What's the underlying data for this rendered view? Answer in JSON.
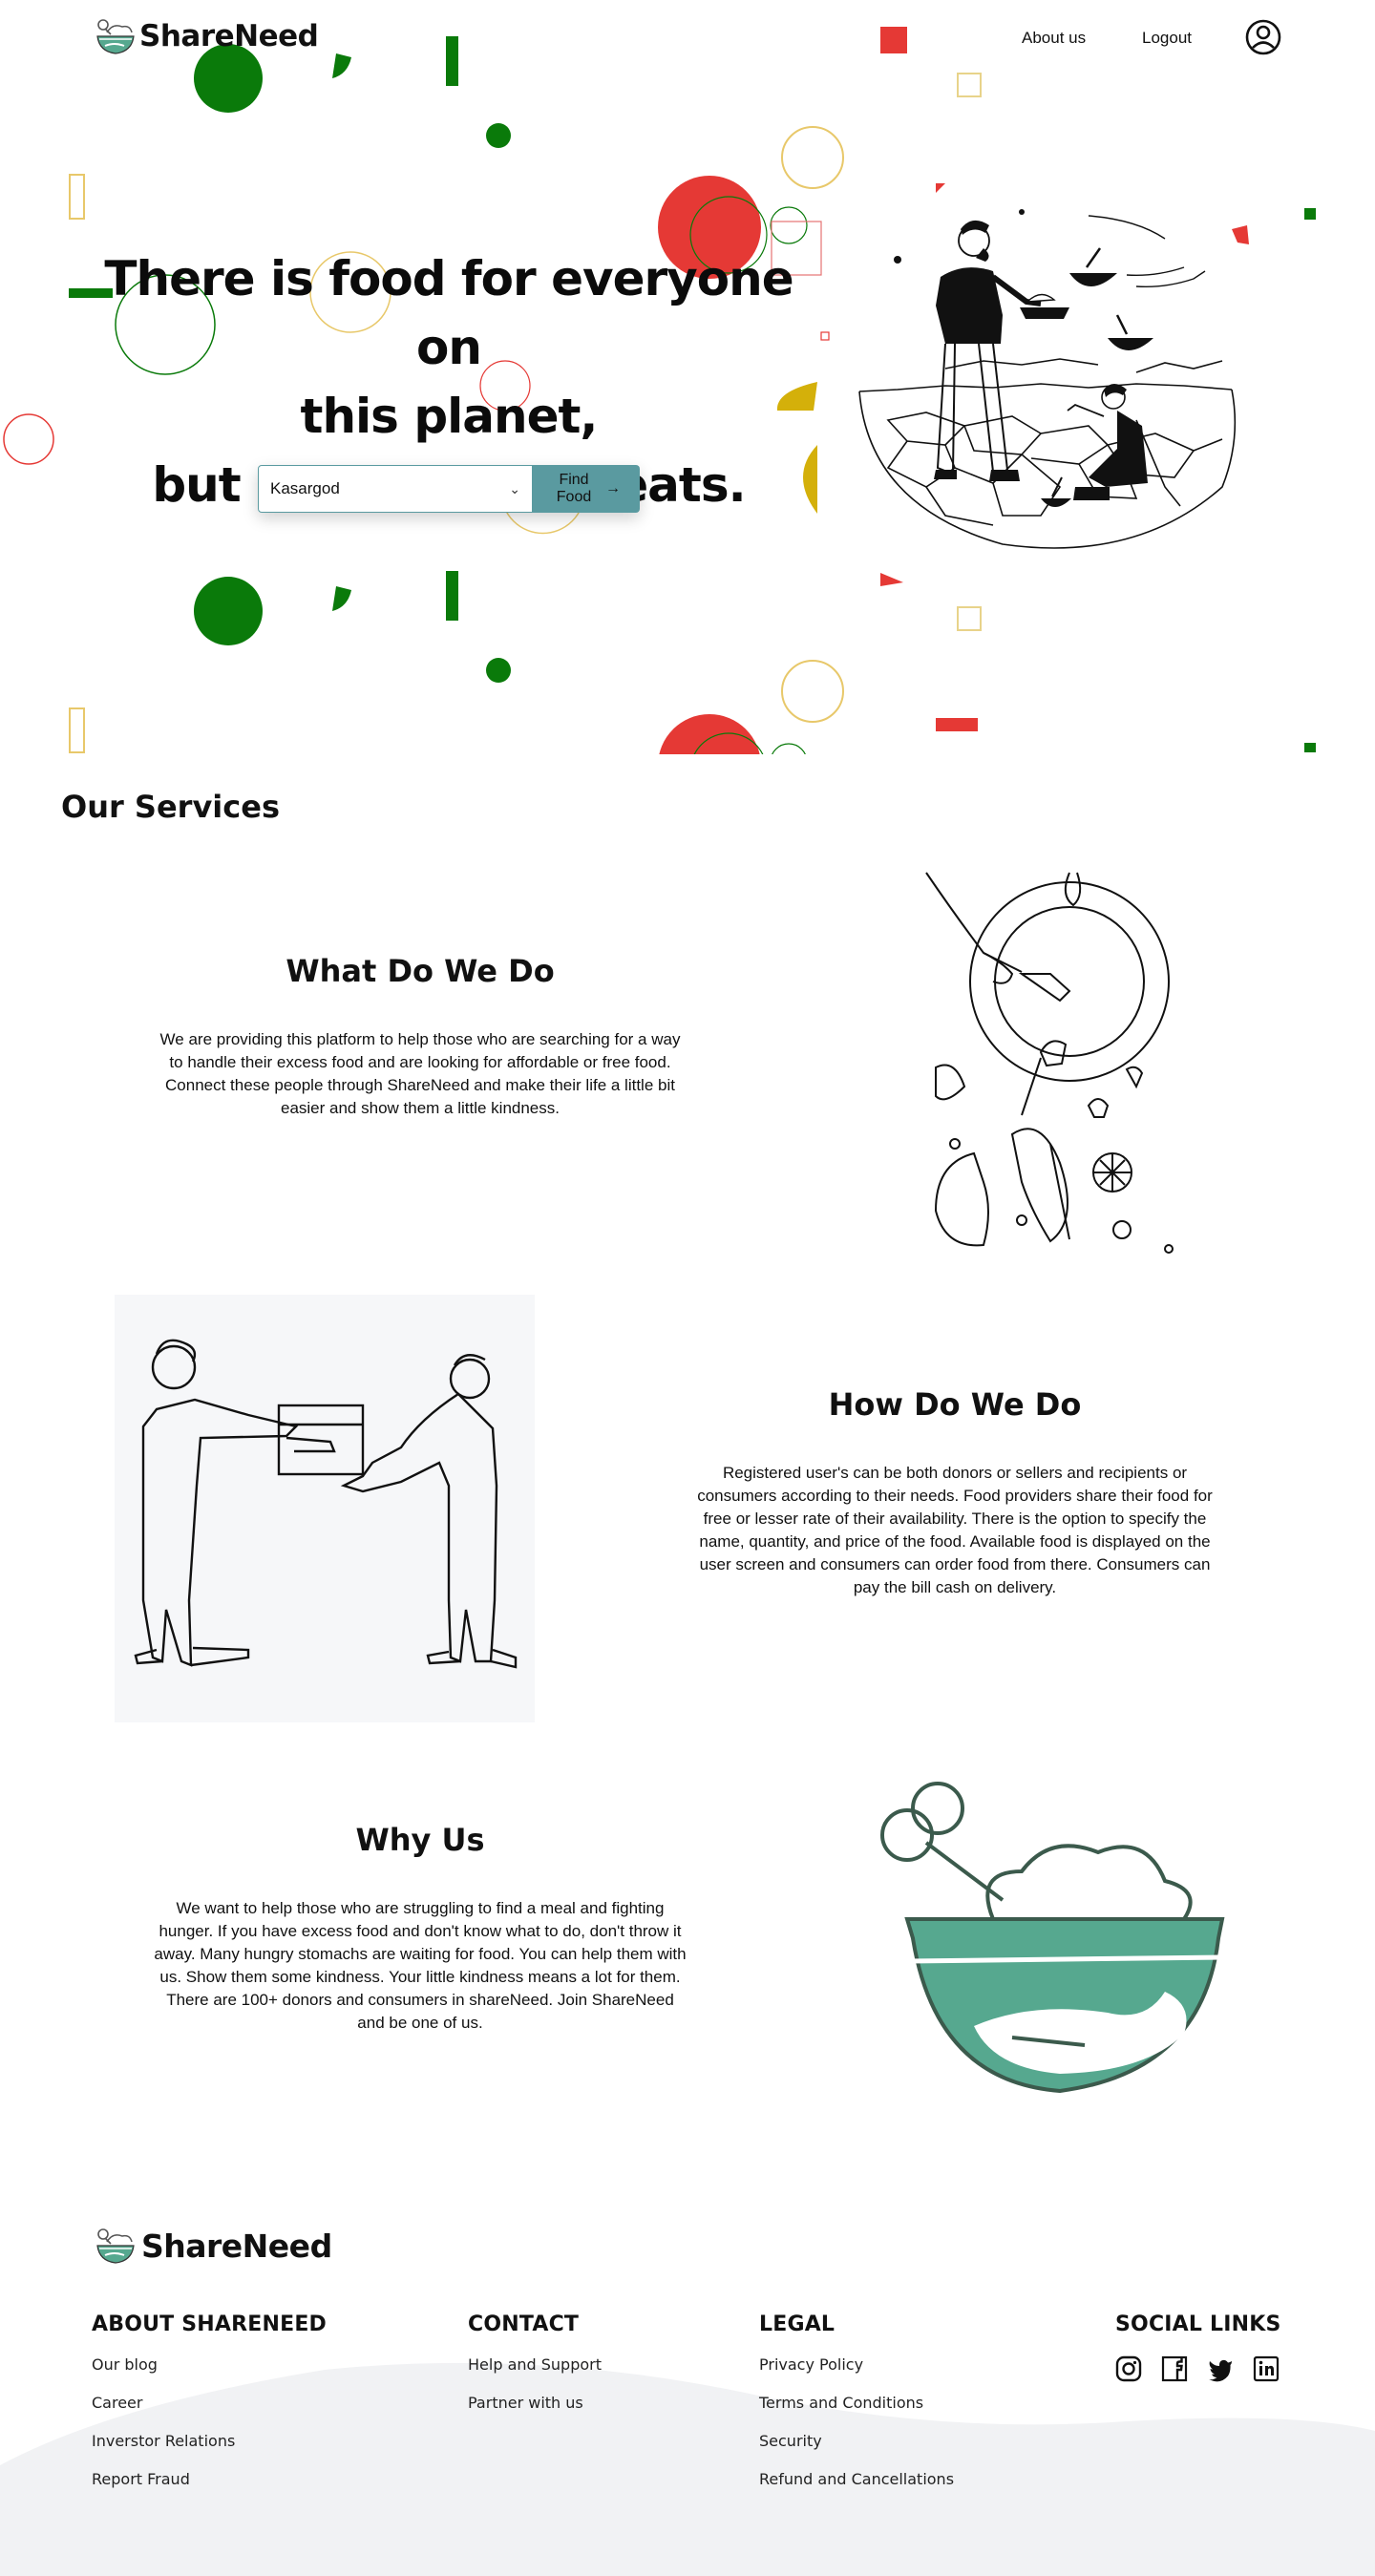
{
  "app": {
    "name": "ShareNeed"
  },
  "header": {
    "brand": "ShareNeed",
    "nav": {
      "about": "About us",
      "logout": "Logout"
    },
    "icons": {
      "logo": "bowl-logo-icon",
      "profile": "user-circle-icon"
    }
  },
  "hero": {
    "title_line1": "There is food for everyone on",
    "title_line2": "this planet,",
    "title_line3": "but not everyone eats.",
    "location_value": "Kasargod",
    "find_button": "Find Food",
    "find_button_line1": "Find",
    "find_button_line2": "Food",
    "colors": {
      "accent": "#5a9aa0",
      "green": "#0a7a0a",
      "red": "#e53935",
      "yellow": "#d4b00a"
    }
  },
  "services": {
    "title": "Our Services",
    "items": [
      {
        "heading": "What Do We Do",
        "text": "We are providing this platform to help those who are searching for a way to handle their excess food and are looking for affordable or free food. Connect these people through ShareNeed and make their life a little bit easier and show them a little kindness."
      },
      {
        "heading": "How Do We Do",
        "text": "Registered user's can be both donors or sellers and recipients or consumers according to their needs. Food providers share their food for free or lesser rate of their availability. There is the option to specify the name, quantity, and price of the food. Available food is displayed on the user screen and consumers can order food from there. Consumers can pay the bill cash on delivery."
      },
      {
        "heading": "Why Us",
        "text": "We want to help those who are struggling to find a meal and fighting hunger. If you have excess food and don't know what to do, don't throw it away. Many hungry stomachs are waiting for food. You can help them with us. Show them some kindness. Your little kindness means a lot for them. There are 100+ donors and consumers in shareNeed. Join ShareNeed and be one of us."
      }
    ]
  },
  "footer": {
    "brand": "ShareNeed",
    "columns": {
      "about": {
        "title": "ABOUT SHARENEED",
        "links": [
          "Our blog",
          "Career",
          "Inverstor Relations",
          "Report Fraud"
        ]
      },
      "contact": {
        "title": "CONTACT",
        "links": [
          "Help and Support",
          "Partner with us"
        ]
      },
      "legal": {
        "title": "LEGAL",
        "links": [
          "Privacy Policy",
          "Terms and Conditions",
          "Security",
          "Refund and Cancellations"
        ]
      },
      "social": {
        "title": "SOCIAL LINKS",
        "icons": [
          "instagram-icon",
          "facebook-icon",
          "twitter-icon",
          "linkedin-icon"
        ]
      }
    }
  }
}
